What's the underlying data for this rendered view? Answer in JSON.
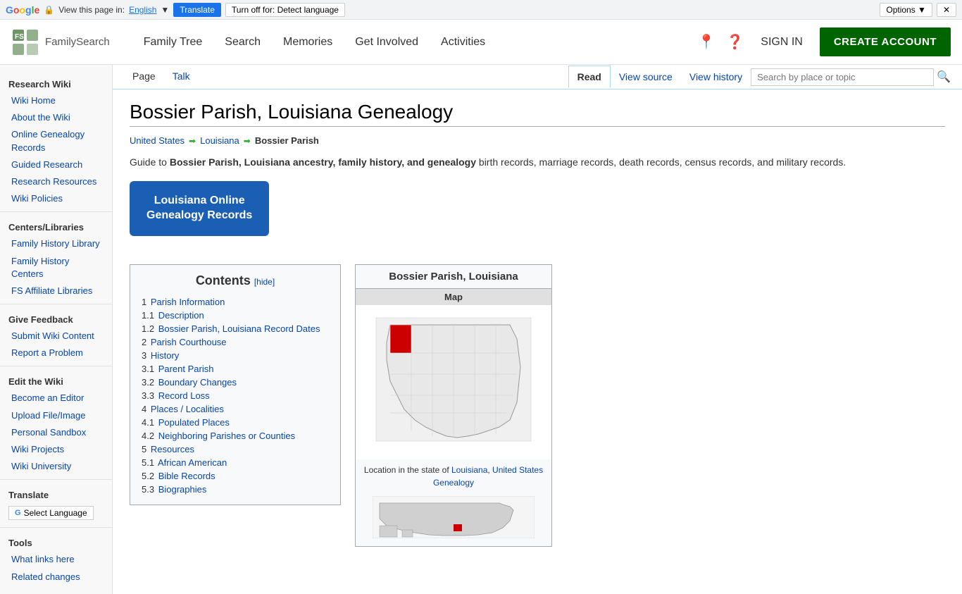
{
  "translate_bar": {
    "view_text": "View this page in:",
    "lang_link": "English",
    "translate_btn": "Translate",
    "turnoff_btn": "Turn off for: Detect language",
    "options_btn": "Options ▼",
    "close_btn": "✕"
  },
  "nav": {
    "logo_alt": "FamilySearch",
    "links": [
      {
        "label": "Family Tree",
        "id": "family-tree"
      },
      {
        "label": "Search",
        "id": "search"
      },
      {
        "label": "Memories",
        "id": "memories"
      },
      {
        "label": "Get Involved",
        "id": "get-involved"
      },
      {
        "label": "Activities",
        "id": "activities"
      }
    ],
    "sign_in": "SIGN IN",
    "create_account": "CREATE ACCOUNT"
  },
  "sidebar": {
    "sections": [
      {
        "title": "Research Wiki",
        "links": [
          {
            "label": "Wiki Home",
            "id": "wiki-home"
          },
          {
            "label": "About the Wiki",
            "id": "about-wiki"
          },
          {
            "label": "Online Genealogy Records",
            "id": "online-genealogy"
          },
          {
            "label": "Guided Research",
            "id": "guided-research"
          },
          {
            "label": "Research Resources",
            "id": "research-resources"
          },
          {
            "label": "Wiki Policies",
            "id": "wiki-policies"
          }
        ]
      },
      {
        "title": "Centers/Libraries",
        "links": [
          {
            "label": "Family History Library",
            "id": "family-history-library"
          },
          {
            "label": "Family History Centers",
            "id": "family-history-centers"
          },
          {
            "label": "FS Affiliate Libraries",
            "id": "fs-affiliate-libraries"
          }
        ]
      },
      {
        "title": "Give Feedback",
        "links": [
          {
            "label": "Submit Wiki Content",
            "id": "submit-wiki"
          },
          {
            "label": "Report a Problem",
            "id": "report-problem"
          }
        ]
      },
      {
        "title": "Edit the Wiki",
        "links": [
          {
            "label": "Become an Editor",
            "id": "become-editor"
          },
          {
            "label": "Upload File/Image",
            "id": "upload-file"
          },
          {
            "label": "Personal Sandbox",
            "id": "personal-sandbox"
          },
          {
            "label": "Wiki Projects",
            "id": "wiki-projects"
          },
          {
            "label": "Wiki University",
            "id": "wiki-university"
          }
        ]
      },
      {
        "title": "Translate",
        "links": [
          {
            "label": "Select Language",
            "id": "select-language"
          }
        ]
      },
      {
        "title": "Tools",
        "links": [
          {
            "label": "What links here",
            "id": "what-links"
          },
          {
            "label": "Related changes",
            "id": "related-changes"
          }
        ]
      }
    ]
  },
  "page_actions": {
    "tabs": [
      {
        "label": "Page",
        "id": "page-tab",
        "active": true
      },
      {
        "label": "Talk",
        "id": "talk-tab",
        "active": false
      }
    ],
    "action_tabs": [
      {
        "label": "Read",
        "id": "read-tab",
        "active": true
      },
      {
        "label": "View source",
        "id": "view-source-tab",
        "active": false
      },
      {
        "label": "View history",
        "id": "view-history-tab",
        "active": false
      }
    ],
    "search_placeholder": "Search by place or topic"
  },
  "article": {
    "title": "Bossier Parish, Louisiana Genealogy",
    "breadcrumb": [
      {
        "label": "United States",
        "id": "us"
      },
      {
        "label": "Louisiana",
        "id": "louisiana"
      },
      {
        "label": "Bossier Parish",
        "id": "bossier",
        "current": true
      }
    ],
    "intro_prefix": "Guide to ",
    "intro_bold": "Bossier Parish, Louisiana ancestry, family history, and genealogy",
    "intro_suffix": " birth records, marriage records, death records, census records, and military records.",
    "la_records_btn": "Louisiana Online\nGenealogy Records",
    "contents": {
      "title": "Contents",
      "hide_label": "[hide]",
      "items": [
        {
          "num": "1",
          "label": "Parish Information",
          "sub": false
        },
        {
          "num": "1.1",
          "label": "Description",
          "sub": true
        },
        {
          "num": "1.2",
          "label": "Bossier Parish, Louisiana Record Dates",
          "sub": true
        },
        {
          "num": "2",
          "label": "Parish Courthouse",
          "sub": false
        },
        {
          "num": "3",
          "label": "History",
          "sub": false
        },
        {
          "num": "3.1",
          "label": "Parent Parish",
          "sub": true
        },
        {
          "num": "3.2",
          "label": "Boundary Changes",
          "sub": true
        },
        {
          "num": "3.3",
          "label": "Record Loss",
          "sub": true
        },
        {
          "num": "4",
          "label": "Places / Localities",
          "sub": false
        },
        {
          "num": "4.1",
          "label": "Populated Places",
          "sub": true
        },
        {
          "num": "4.2",
          "label": "Neighboring Parishes or Counties",
          "sub": true
        },
        {
          "num": "5",
          "label": "Resources",
          "sub": false
        },
        {
          "num": "5.1",
          "label": "African American",
          "sub": true
        },
        {
          "num": "5.2",
          "label": "Bible Records",
          "sub": true
        },
        {
          "num": "5.3",
          "label": "Biographies",
          "sub": true
        }
      ]
    },
    "map_box": {
      "title": "Bossier Parish, Louisiana",
      "subtitle": "Map",
      "caption_prefix": "Location in the state of ",
      "caption_link1": "Louisiana",
      "caption_middle": ", ",
      "caption_link2": "United States Genealogy"
    }
  }
}
